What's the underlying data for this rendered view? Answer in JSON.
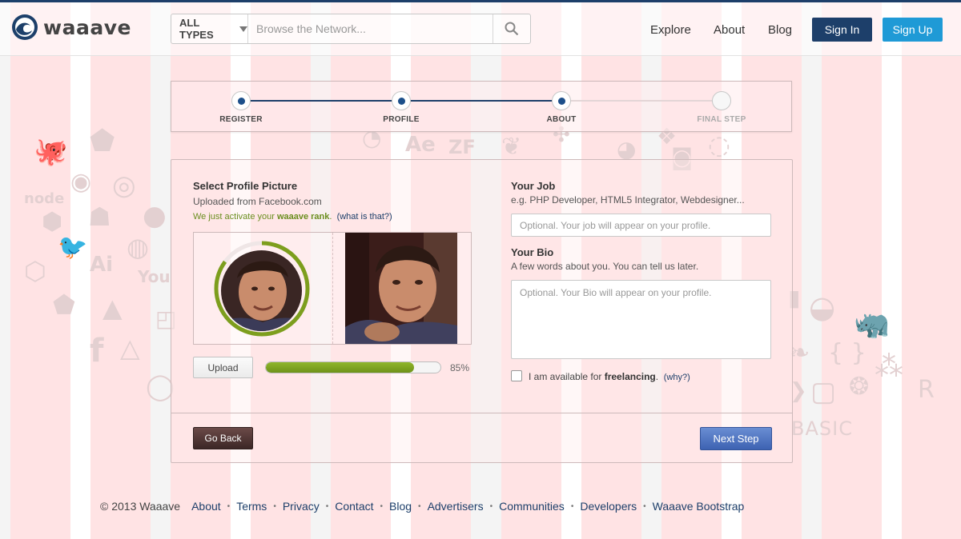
{
  "header": {
    "logo_text": "waaave",
    "search": {
      "type_label": "ALL TYPES",
      "placeholder": "Browse the Network..."
    },
    "nav": [
      "Explore",
      "About",
      "Blog"
    ],
    "signin_label": "Sign In",
    "signup_label": "Sign Up"
  },
  "steps": [
    {
      "label": "REGISTER",
      "done": true
    },
    {
      "label": "PROFILE",
      "done": true
    },
    {
      "label": "ABOUT",
      "done": true
    },
    {
      "label": "FINAL STEP",
      "done": false
    }
  ],
  "profile_picture": {
    "title": "Select Profile Picture",
    "subtitle": "Uploaded from Facebook.com",
    "rank_text_before": "We just activate your ",
    "rank_bold": "waaave rank",
    "rank_text_after": ".",
    "rank_link": "(what is that?)",
    "upload_label": "Upload",
    "progress_percent": 85,
    "progress_text": "85%"
  },
  "job": {
    "title": "Your Job",
    "hint": "e.g. PHP Developer, HTML5 Integrator, Webdesigner...",
    "placeholder": "Optional. Your job will appear on your profile."
  },
  "bio": {
    "title": "Your Bio",
    "hint": "A few words about you. You can tell us later.",
    "placeholder": "Optional. Your Bio will appear on your profile."
  },
  "freelance": {
    "text_before": "I am available for ",
    "text_bold": "freelancing",
    "text_after": ".",
    "link": "(why?)",
    "checked": false
  },
  "actions": {
    "back_label": "Go Back",
    "next_label": "Next Step"
  },
  "footer": {
    "copyright": "© 2013 Waaave",
    "links": [
      "About",
      "Terms",
      "Privacy",
      "Contact",
      "Blog",
      "Advertisers",
      "Communities",
      "Developers",
      "Waaave Bootstrap"
    ]
  },
  "colors": {
    "brand_dark": "#1d3f6a",
    "brand_light": "#1f9ad6",
    "rank_green": "#6b8e1f"
  }
}
